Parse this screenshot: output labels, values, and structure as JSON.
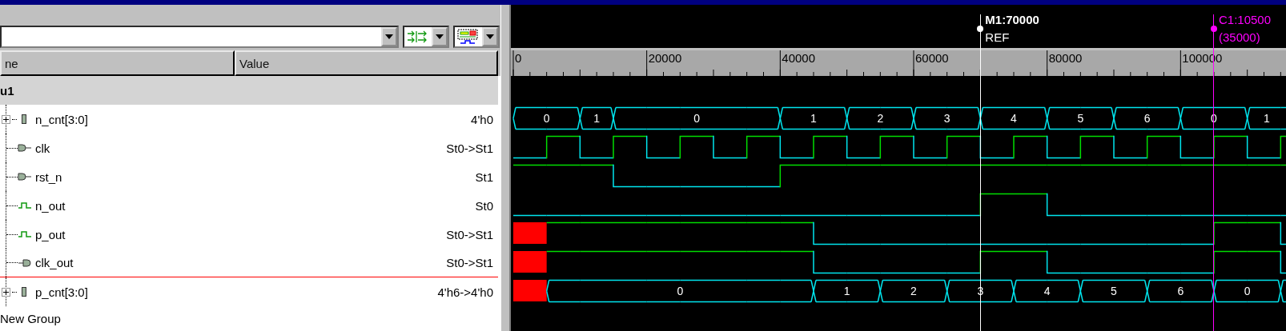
{
  "columns": [
    "ne",
    "Value"
  ],
  "group": {
    "name": "u1"
  },
  "signals": [
    {
      "name": "n_cnt[3:0]",
      "value": "4'h0",
      "kind": "bus",
      "expanded": false,
      "insert_line_below": false,
      "wave": [
        {
          "continues": false,
          "value": "0"
        },
        {
          "continues": true
        },
        {
          "continues": false,
          "value": "1"
        },
        {
          "continues": false,
          "value": "0"
        },
        {
          "continues": true
        },
        {
          "continues": true
        },
        {
          "continues": true
        },
        {
          "continues": true
        },
        {
          "continues": false,
          "value": "1"
        },
        {
          "continues": true
        },
        {
          "continues": false,
          "value": "2"
        },
        {
          "continues": true
        },
        {
          "continues": false,
          "value": "3"
        },
        {
          "continues": true
        },
        {
          "continues": false,
          "value": "4"
        },
        {
          "continues": true
        },
        {
          "continues": false,
          "value": "5"
        },
        {
          "continues": true
        },
        {
          "continues": false,
          "value": "6"
        },
        {
          "continues": true
        },
        {
          "continues": false,
          "value": "0"
        },
        {
          "continues": true
        },
        {
          "continues": false,
          "value": "1"
        },
        {
          "continues": true
        }
      ]
    },
    {
      "name": "clk",
      "value": "St0->St1",
      "kind": "input",
      "insert_line_below": false,
      "wave": [
        {
          "high": false
        },
        {
          "high": true
        },
        {
          "high": false
        },
        {
          "high": true
        },
        {
          "high": false
        },
        {
          "high": true
        },
        {
          "high": false
        },
        {
          "high": true
        },
        {
          "high": false
        },
        {
          "high": true
        },
        {
          "high": false
        },
        {
          "high": true
        },
        {
          "high": false
        },
        {
          "high": true
        },
        {
          "high": false
        },
        {
          "high": true
        },
        {
          "high": false
        },
        {
          "high": true
        },
        {
          "high": false
        },
        {
          "high": true
        },
        {
          "high": false
        },
        {
          "high": true
        },
        {
          "high": false
        },
        {
          "high": true
        }
      ]
    },
    {
      "name": "rst_n",
      "value": "St1",
      "kind": "input",
      "insert_line_below": false,
      "wave": [
        {
          "high": true
        },
        {
          "high": true
        },
        {
          "high": true
        },
        {
          "high": false
        },
        {
          "high": false
        },
        {
          "high": false
        },
        {
          "high": false
        },
        {
          "high": false
        },
        {
          "high": true
        },
        {
          "high": true
        },
        {
          "high": true
        },
        {
          "high": true
        },
        {
          "high": true
        },
        {
          "high": true
        },
        {
          "high": true
        },
        {
          "high": true
        },
        {
          "high": true
        },
        {
          "high": true
        },
        {
          "high": true
        },
        {
          "high": true
        },
        {
          "high": true
        },
        {
          "high": true
        },
        {
          "high": true
        },
        {
          "high": true
        }
      ]
    },
    {
      "name": "n_out",
      "value": "St0",
      "kind": "signal",
      "insert_line_below": false,
      "wave": [
        {
          "high": false
        },
        {
          "high": false
        },
        {
          "high": false
        },
        {
          "high": false
        },
        {
          "high": false
        },
        {
          "high": false
        },
        {
          "high": false
        },
        {
          "high": false
        },
        {
          "high": false
        },
        {
          "high": false
        },
        {
          "high": false
        },
        {
          "high": false
        },
        {
          "high": false
        },
        {
          "high": false
        },
        {
          "high": true
        },
        {
          "high": true
        },
        {
          "high": false
        },
        {
          "high": false
        },
        {
          "high": false
        },
        {
          "high": false
        },
        {
          "high": false
        },
        {
          "high": false
        },
        {
          "high": false
        },
        {
          "high": false
        }
      ]
    },
    {
      "name": "p_out",
      "value": "St0->St1",
      "kind": "signal",
      "insert_line_below": false,
      "wave": [
        {
          "unknown": true
        },
        {
          "high": true
        },
        {
          "high": true
        },
        {
          "high": true
        },
        {
          "high": true
        },
        {
          "high": true
        },
        {
          "high": true
        },
        {
          "high": true
        },
        {
          "high": true
        },
        {
          "high": false
        },
        {
          "high": false
        },
        {
          "high": false
        },
        {
          "high": false
        },
        {
          "high": false
        },
        {
          "high": false
        },
        {
          "high": false
        },
        {
          "high": false
        },
        {
          "high": false
        },
        {
          "high": false
        },
        {
          "high": false
        },
        {
          "high": false
        },
        {
          "high": true
        },
        {
          "high": true
        },
        {
          "high": false
        }
      ]
    },
    {
      "name": "clk_out",
      "value": "St0->St1",
      "kind": "output",
      "insert_line_below": true,
      "wave": [
        {
          "unknown": true
        },
        {
          "high": true
        },
        {
          "high": true
        },
        {
          "high": true
        },
        {
          "high": true
        },
        {
          "high": true
        },
        {
          "high": true
        },
        {
          "high": true
        },
        {
          "high": true
        },
        {
          "high": false
        },
        {
          "high": false
        },
        {
          "high": false
        },
        {
          "high": false
        },
        {
          "high": false
        },
        {
          "high": true
        },
        {
          "high": true
        },
        {
          "high": false
        },
        {
          "high": false
        },
        {
          "high": false
        },
        {
          "high": false
        },
        {
          "high": false
        },
        {
          "high": true
        },
        {
          "high": true
        },
        {
          "high": false
        }
      ]
    },
    {
      "name": "p_cnt[3:0]",
      "value": "4'h6->4'h0",
      "kind": "bus",
      "expanded": false,
      "insert_line_below": false,
      "wave": [
        {
          "unknown": true
        },
        {
          "continues": false,
          "value": "0"
        },
        {
          "continues": true
        },
        {
          "continues": true
        },
        {
          "continues": true
        },
        {
          "continues": true
        },
        {
          "continues": true
        },
        {
          "continues": true
        },
        {
          "continues": true
        },
        {
          "continues": false,
          "value": "1"
        },
        {
          "continues": true
        },
        {
          "continues": false,
          "value": "2"
        },
        {
          "continues": true
        },
        {
          "continues": false,
          "value": "3"
        },
        {
          "continues": true
        },
        {
          "continues": false,
          "value": "4"
        },
        {
          "continues": true
        },
        {
          "continues": false,
          "value": "5"
        },
        {
          "continues": true
        },
        {
          "continues": false,
          "value": "6"
        },
        {
          "continues": true
        },
        {
          "continues": false,
          "value": "0"
        },
        {
          "continues": true
        },
        {
          "continues": false
        }
      ]
    }
  ],
  "trailing_group": {
    "name": "New Group"
  },
  "ruler": {
    "labels": [
      "0",
      "20000",
      "40000",
      "60000",
      "80000",
      "100000"
    ]
  },
  "markers": [
    {
      "name": "M1:70000",
      "note": "REF",
      "kind": "reference",
      "level": 0.6045
    },
    {
      "name": "C1:10500",
      "note": "(35000)",
      "kind": "cursor",
      "level": 0.9067
    }
  ]
}
